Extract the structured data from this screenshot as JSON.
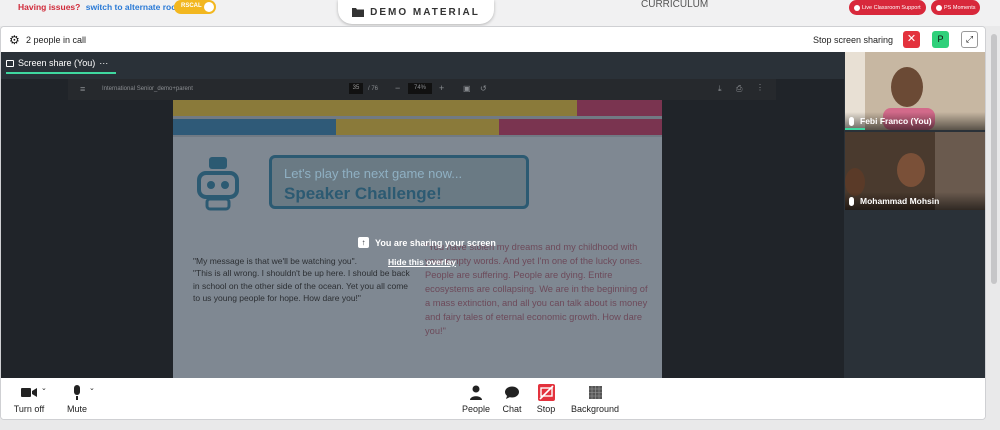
{
  "topbar": {
    "issues_text": "Having issues?",
    "issues_link": "switch to alternate room",
    "toggle_label": "RSCAL",
    "demo_title": "DEMO MATERIAL",
    "curriculum": "CURRICULUM",
    "support_button": "Live Classroom Support",
    "moments_button": "PS Moments"
  },
  "call": {
    "people_count": "2 people in call",
    "stop_sharing_label": "Stop screen sharing",
    "p_badge": "P",
    "share_tab": "Screen share (You)",
    "share_tab_more": "···"
  },
  "pdf": {
    "filename": "International Senior_demo+parent",
    "page_current": "35",
    "page_total": "/ 76",
    "zoom": "74%",
    "bubble_line1": "Let's play the next game now...",
    "bubble_line2": "Speaker Challenge!",
    "quote_left": "\"My message is that we'll be watching you\".\n\"This is all wrong. I shouldn't be up here. I should be back in school on the other side of the ocean. Yet you all come to us young people for hope. How dare you!\"",
    "quote_right": "\"You have stolen my dreams and my childhood with your empty words. And yet I'm one of the lucky ones. People are suffering. People are dying. Entire ecosystems are collapsing. We are in the beginning of a mass extinction, and all you can talk about is money and fairy tales of eternal economic growth. How dare you!\""
  },
  "overlay": {
    "sharing_text": "You are sharing your screen",
    "hide_link": "Hide this overlay"
  },
  "participants": [
    {
      "name": "Febi Franco (You)"
    },
    {
      "name": "Mohammad Mohsin"
    }
  ],
  "controls": {
    "camera": "Turn off",
    "mic": "Mute",
    "people": "People",
    "chat": "Chat",
    "stop": "Stop",
    "background": "Background"
  },
  "colors": {
    "accent_red": "#e3323d",
    "accent_green": "#2fd07a",
    "band_yellow": "#d8b43a",
    "band_pink": "#c0426e",
    "band_blue": "#3a78a8"
  }
}
